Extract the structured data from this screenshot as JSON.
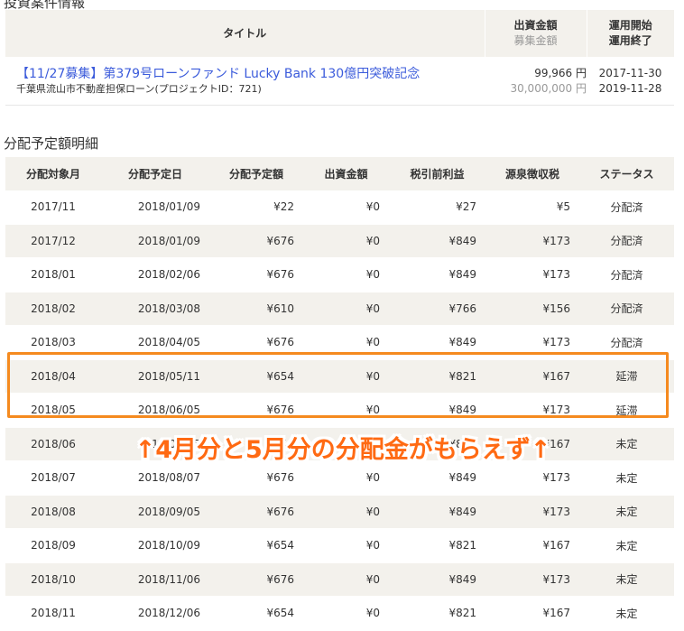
{
  "top_heading_partial": "投資案件情報",
  "fund_table": {
    "headers": {
      "title": "タイトル",
      "amount": "出資金額",
      "amount_sub": "募集金額",
      "period": "運用開始",
      "period_sub": "運用終了"
    },
    "row": {
      "title": "【11/27募集】第379号ローンファンド Lucky Bank 130億円突破記念",
      "subtitle": "千葉県流山市不動産担保ローン(プロジェクトID：721)",
      "invested": "99,966 円",
      "target": "30,000,000 円",
      "start": "2017-11-30",
      "end": "2019-11-28"
    }
  },
  "schedule_title": "分配予定額明細",
  "schedule_table": {
    "headers": [
      "分配対象月",
      "分配予定日",
      "分配予定額",
      "出資金額",
      "税引前利益",
      "源泉徴収税",
      "ステータス"
    ],
    "rows": [
      [
        "2017/11",
        "2018/01/09",
        "¥22",
        "¥0",
        "¥27",
        "¥5",
        "分配済"
      ],
      [
        "2017/12",
        "2018/01/09",
        "¥676",
        "¥0",
        "¥849",
        "¥173",
        "分配済"
      ],
      [
        "2018/01",
        "2018/02/06",
        "¥676",
        "¥0",
        "¥849",
        "¥173",
        "分配済"
      ],
      [
        "2018/02",
        "2018/03/08",
        "¥610",
        "¥0",
        "¥766",
        "¥156",
        "分配済"
      ],
      [
        "2018/03",
        "2018/04/05",
        "¥676",
        "¥0",
        "¥849",
        "¥173",
        "分配済"
      ],
      [
        "2018/04",
        "2018/05/11",
        "¥654",
        "¥0",
        "¥821",
        "¥167",
        "延滞"
      ],
      [
        "2018/05",
        "2018/06/05",
        "¥676",
        "¥0",
        "¥849",
        "¥173",
        "延滞"
      ],
      [
        "2018/06",
        "2018/07/05",
        "¥654",
        "¥0",
        "¥821",
        "¥167",
        "未定"
      ],
      [
        "2018/07",
        "2018/08/07",
        "¥676",
        "¥0",
        "¥849",
        "¥173",
        "未定"
      ],
      [
        "2018/08",
        "2018/09/05",
        "¥676",
        "¥0",
        "¥849",
        "¥173",
        "未定"
      ],
      [
        "2018/09",
        "2018/10/09",
        "¥654",
        "¥0",
        "¥821",
        "¥167",
        "未定"
      ],
      [
        "2018/10",
        "2018/11/06",
        "¥676",
        "¥0",
        "¥849",
        "¥173",
        "未定"
      ],
      [
        "2018/11",
        "2018/12/06",
        "¥654",
        "¥0",
        "¥821",
        "¥167",
        "未定"
      ]
    ]
  },
  "annotation": "↑4月分と5月分の分配金がもらえず↑",
  "colors": {
    "paid": "#1a56c4",
    "delayed": "#d22b2b",
    "highlight": "#f58a1f",
    "annotation": "#ff6a13",
    "header_bg": "#f3f1ec"
  }
}
